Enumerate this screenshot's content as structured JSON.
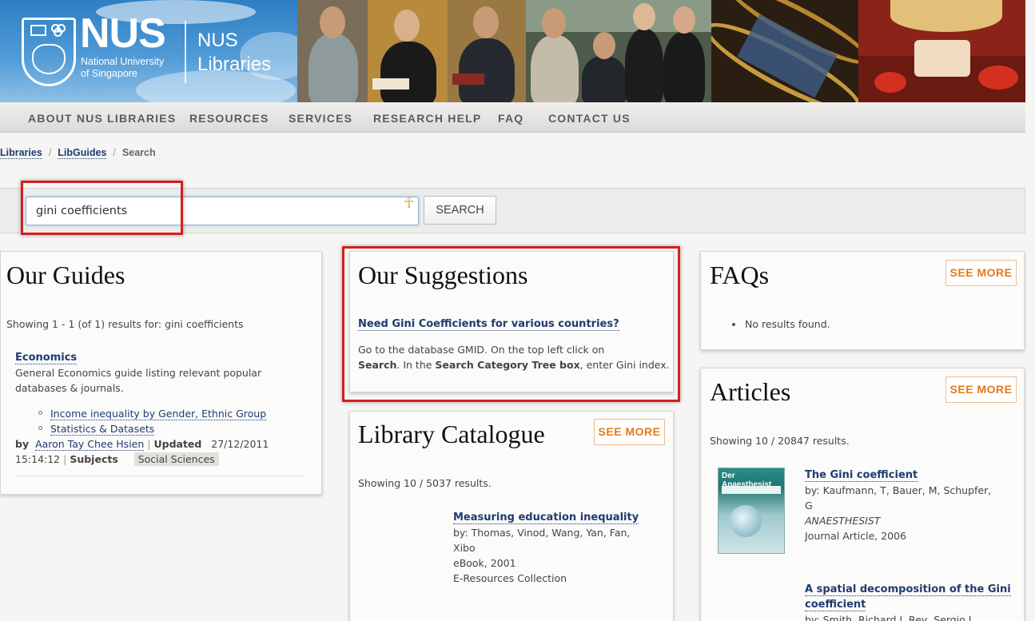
{
  "brand": {
    "logo_main": "NUS",
    "logo_sub_line1": "National University",
    "logo_sub_line2": "of Singapore",
    "libraries_line1": "NUS",
    "libraries_line2": "Libraries"
  },
  "nav": {
    "items": [
      {
        "label": "ABOUT NUS LIBRARIES"
      },
      {
        "label": "RESOURCES"
      },
      {
        "label": "SERVICES"
      },
      {
        "label": "RESEARCH HELP"
      },
      {
        "label": "FAQ"
      },
      {
        "label": "CONTACT US"
      }
    ]
  },
  "breadcrumb": {
    "items": [
      "Libraries",
      "LibGuides"
    ],
    "separator": "/",
    "current": "Search"
  },
  "search": {
    "value": "gini coefficients",
    "button_label": "SEARCH"
  },
  "guides": {
    "title": "Our Guides",
    "showing": "Showing 1 - 1 (of 1) results for: gini coefficients",
    "result_title": "Economics",
    "result_desc_line1": "General Economics guide listing relevant popular",
    "result_desc_line2": "databases & journals.",
    "sub_links": [
      "Income inequality by Gender, Ethnic Group",
      "Statistics & Datasets"
    ],
    "by_label": "by",
    "author": "Aaron Tay Chee Hsien",
    "sep": "|",
    "updated_label": "Updated",
    "updated_date": "27/12/2011",
    "updated_time": "15:14:12",
    "subjects_label": "Subjects",
    "subject": "Social Sciences"
  },
  "suggestions": {
    "title": "Our Suggestions",
    "link": "Need Gini Coefficients for various countries?",
    "line1": "Go to  the database GMID. On the top left click on",
    "bold1": "Search",
    "mid": ". In the ",
    "bold2": "Search Category Tree box",
    "end": ", enter Gini index."
  },
  "catalogue": {
    "title": "Library Catalogue",
    "see_more": "SEE MORE",
    "showing": "Showing 10 / 5037 results.",
    "item_title": "Measuring education inequality",
    "item_by_line1": "by: Thomas, Vinod, Wang, Yan, Fan,",
    "item_by_line2": "Xibo",
    "item_type": "eBook, 2001",
    "item_collection": "E-Resources Collection"
  },
  "faqs": {
    "title": "FAQs",
    "see_more": "SEE MORE",
    "empty": "No results found."
  },
  "articles": {
    "title": "Articles",
    "see_more": "SEE MORE",
    "showing": "Showing 10 / 20847 results.",
    "thumb_title": "Der Anaesthesist",
    "item1_title": "The Gini coefficient",
    "item1_by_line1": "by: Kaufmann, T, Bauer, M, Schupfer,",
    "item1_by_line2": "G",
    "item1_journal": "ANAESTHESIST",
    "item1_type": "Journal Article, 2006",
    "item2_title_line1": "A spatial decomposition of the Gini",
    "item2_title_line2": "coefficient",
    "item2_by": "by: Smith, Richard J, Rey, Sergio J"
  },
  "colors": {
    "link": "#1f3b70",
    "accent_orange": "#e07a1a",
    "highlight_red": "#d41f1f"
  }
}
